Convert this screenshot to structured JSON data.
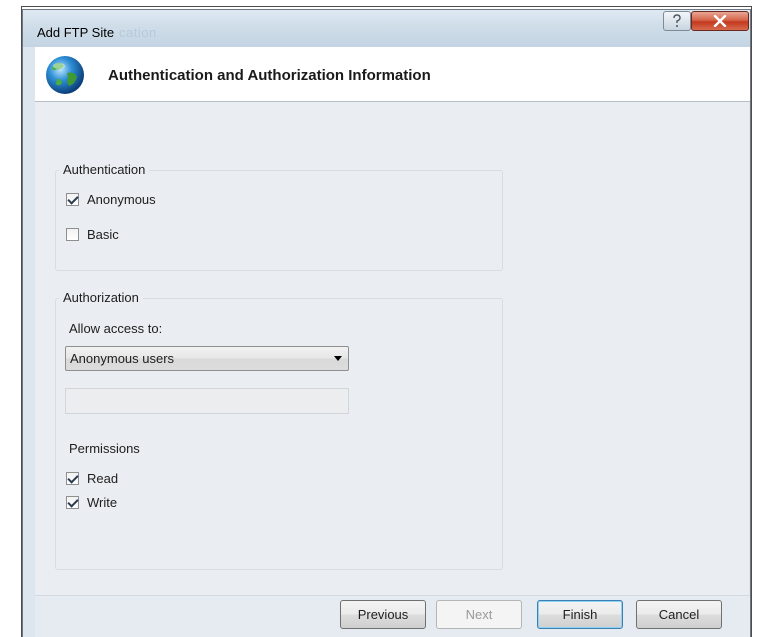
{
  "window": {
    "title": "Add FTP Site",
    "title_ghost": "cation"
  },
  "header": {
    "icon": "globe-icon",
    "title": "Authentication and Authorization Information"
  },
  "authentication": {
    "label": "Authentication",
    "anonymous": {
      "label": "Anonymous",
      "checked": true
    },
    "basic": {
      "label": "Basic",
      "checked": false
    }
  },
  "authorization": {
    "label": "Authorization",
    "allow_access_label": "Allow access to:",
    "allow_access_value": "Anonymous users",
    "users_field_value": "",
    "permissions_label": "Permissions",
    "read": {
      "label": "Read",
      "checked": true
    },
    "write": {
      "label": "Write",
      "checked": true
    }
  },
  "buttons": {
    "previous": "Previous",
    "next": "Next",
    "finish": "Finish",
    "cancel": "Cancel"
  },
  "colors": {
    "close_button": "#c4391f",
    "titlebar": "#cfdde9",
    "dialog_bg": "#eaedf1"
  }
}
